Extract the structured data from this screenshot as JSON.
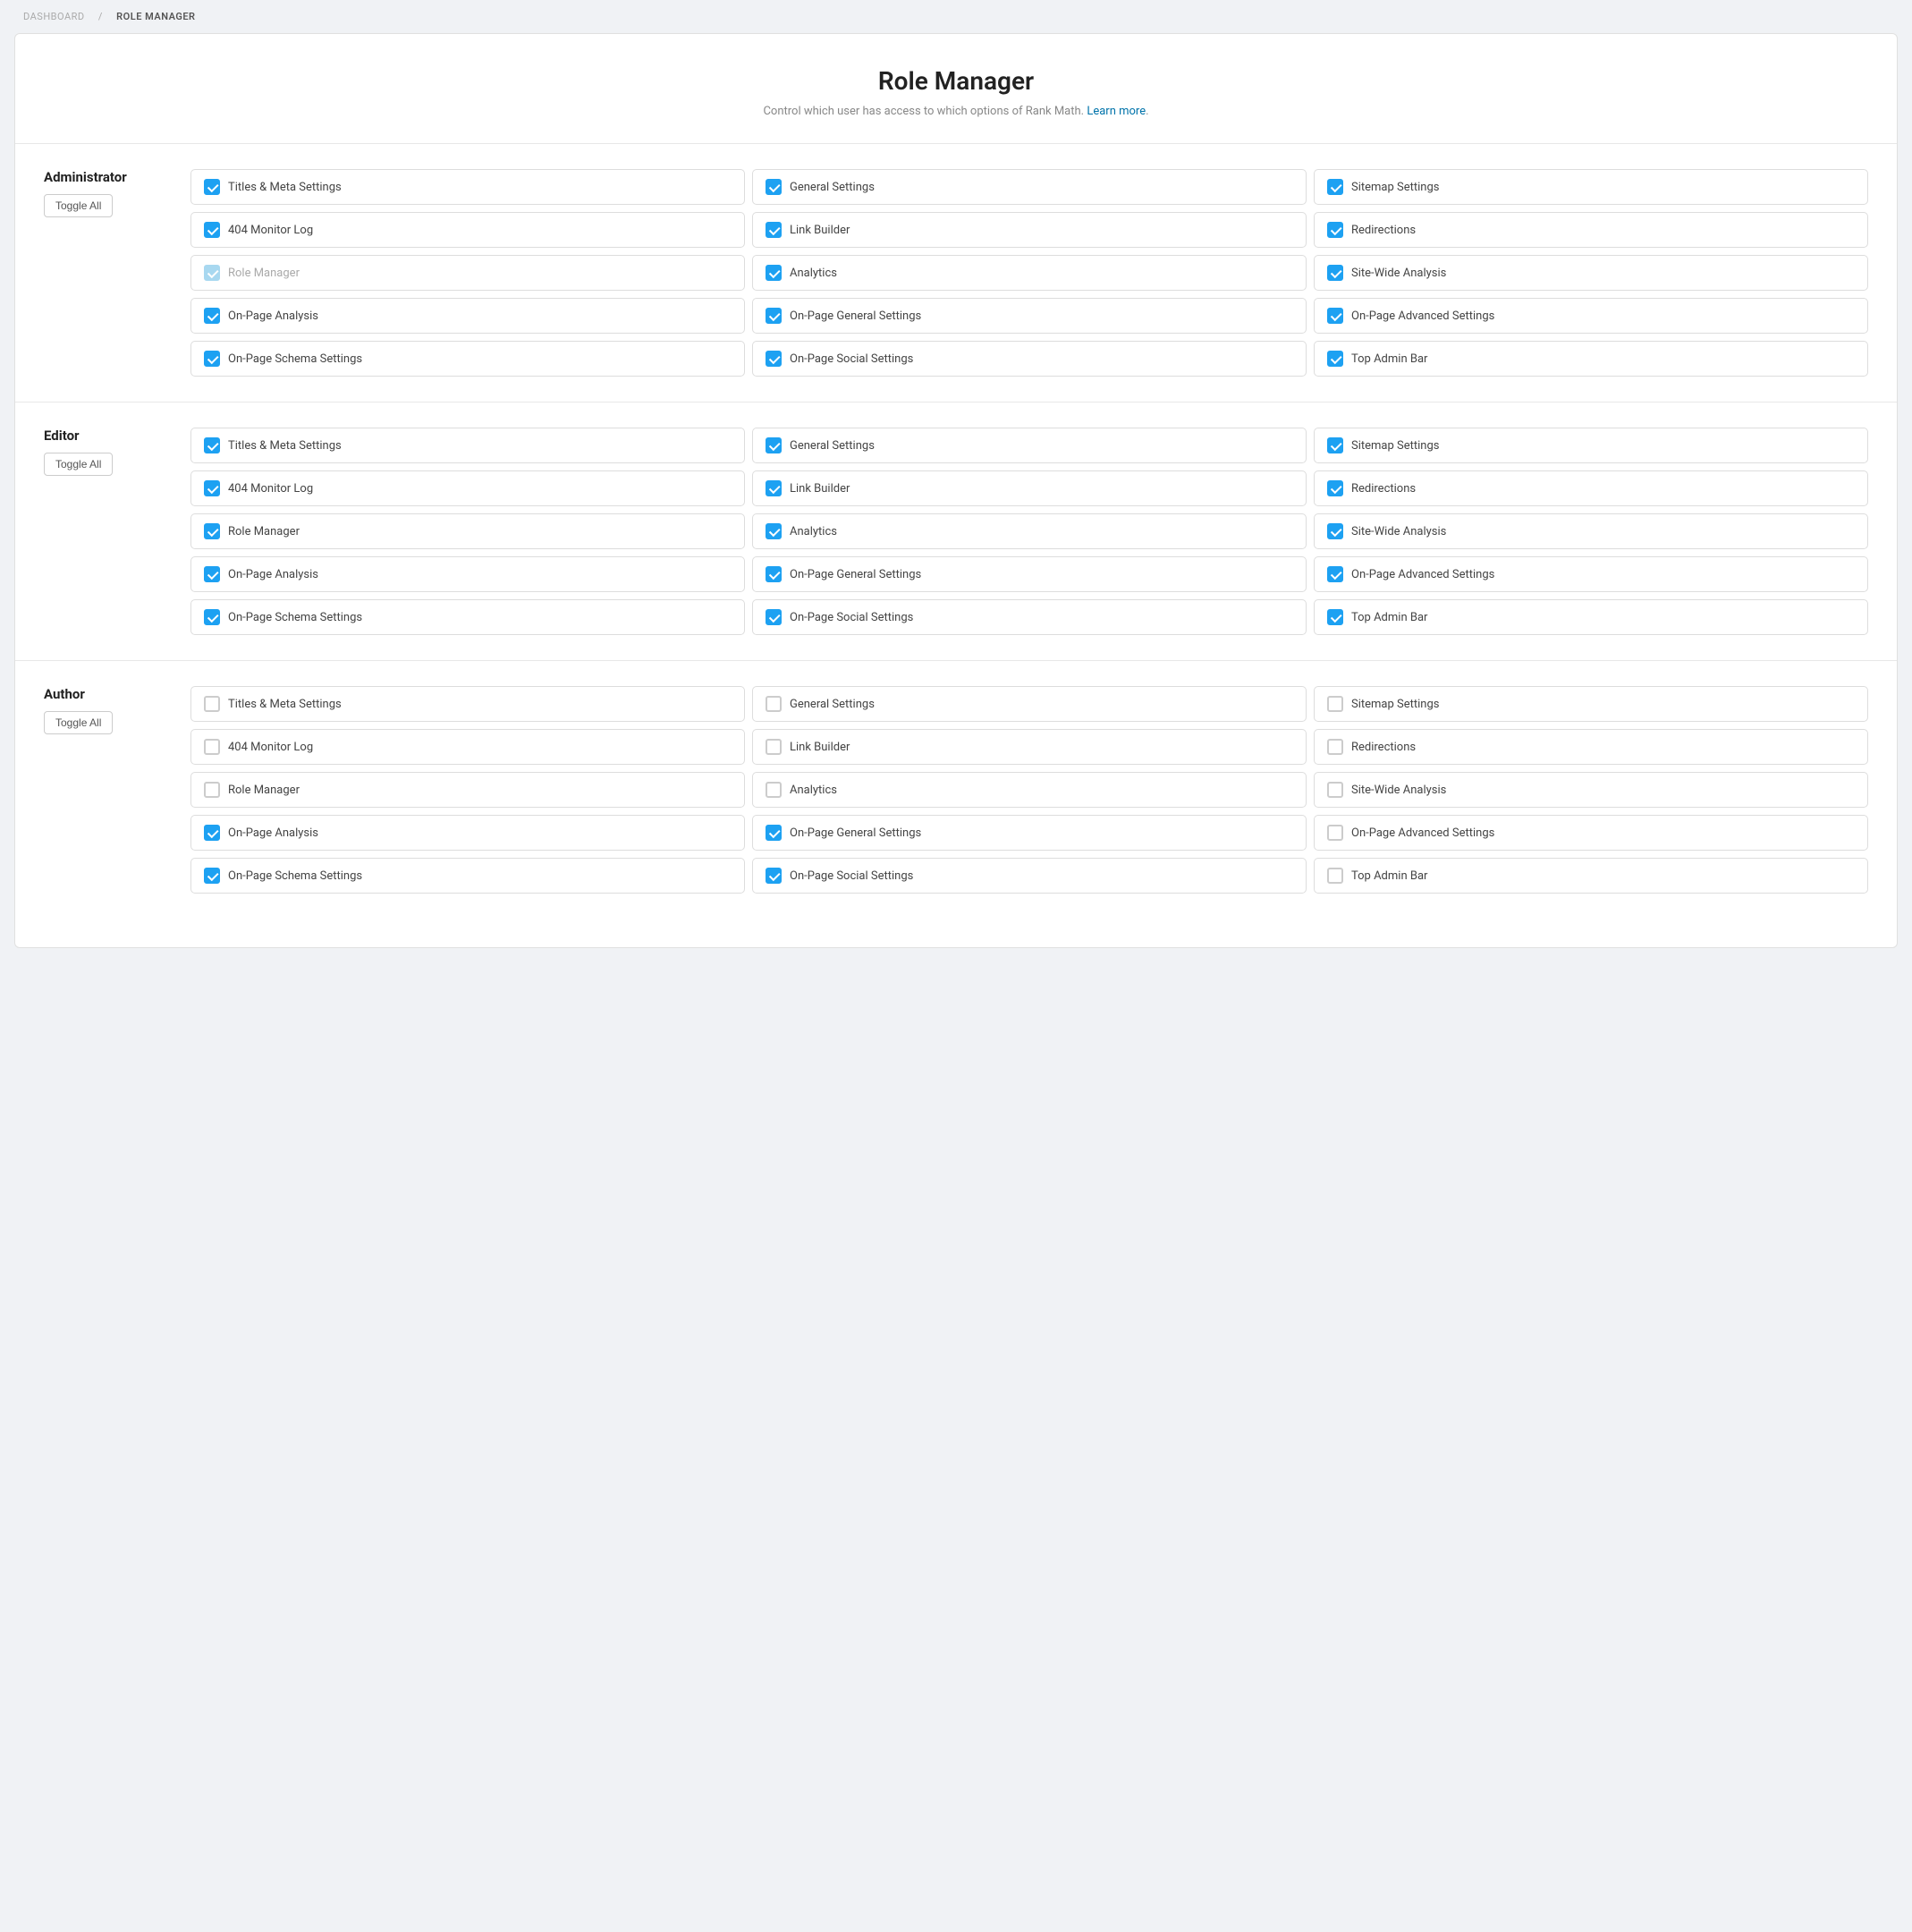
{
  "breadcrumb": {
    "dashboard": "DASHBOARD",
    "separator": "/",
    "current": "ROLE MANAGER"
  },
  "page": {
    "title": "Role Manager",
    "subtitle": "Control which user has access to which options of Rank Math.",
    "learn_more": "Learn more",
    "period": "."
  },
  "roles": [
    {
      "id": "administrator",
      "name": "Administrator",
      "toggle_label": "Toggle All",
      "permissions": [
        {
          "label": "Titles & Meta Settings",
          "state": "checked"
        },
        {
          "label": "General Settings",
          "state": "checked"
        },
        {
          "label": "Sitemap Settings",
          "state": "checked"
        },
        {
          "label": "404 Monitor Log",
          "state": "checked"
        },
        {
          "label": "Link Builder",
          "state": "checked"
        },
        {
          "label": "Redirections",
          "state": "checked"
        },
        {
          "label": "Role Manager",
          "state": "disabled-checked"
        },
        {
          "label": "Analytics",
          "state": "checked"
        },
        {
          "label": "Site-Wide Analysis",
          "state": "checked"
        },
        {
          "label": "On-Page Analysis",
          "state": "checked"
        },
        {
          "label": "On-Page General Settings",
          "state": "checked"
        },
        {
          "label": "On-Page Advanced Settings",
          "state": "checked"
        },
        {
          "label": "On-Page Schema Settings",
          "state": "checked"
        },
        {
          "label": "On-Page Social Settings",
          "state": "checked"
        },
        {
          "label": "Top Admin Bar",
          "state": "checked"
        }
      ]
    },
    {
      "id": "editor",
      "name": "Editor",
      "toggle_label": "Toggle All",
      "permissions": [
        {
          "label": "Titles & Meta Settings",
          "state": "checked"
        },
        {
          "label": "General Settings",
          "state": "checked"
        },
        {
          "label": "Sitemap Settings",
          "state": "checked"
        },
        {
          "label": "404 Monitor Log",
          "state": "checked"
        },
        {
          "label": "Link Builder",
          "state": "checked"
        },
        {
          "label": "Redirections",
          "state": "checked"
        },
        {
          "label": "Role Manager",
          "state": "checked"
        },
        {
          "label": "Analytics",
          "state": "checked"
        },
        {
          "label": "Site-Wide Analysis",
          "state": "checked"
        },
        {
          "label": "On-Page Analysis",
          "state": "checked"
        },
        {
          "label": "On-Page General Settings",
          "state": "checked"
        },
        {
          "label": "On-Page Advanced Settings",
          "state": "checked"
        },
        {
          "label": "On-Page Schema Settings",
          "state": "checked"
        },
        {
          "label": "On-Page Social Settings",
          "state": "checked"
        },
        {
          "label": "Top Admin Bar",
          "state": "checked"
        }
      ]
    },
    {
      "id": "author",
      "name": "Author",
      "toggle_label": "Toggle All",
      "permissions": [
        {
          "label": "Titles & Meta Settings",
          "state": "unchecked"
        },
        {
          "label": "General Settings",
          "state": "unchecked"
        },
        {
          "label": "Sitemap Settings",
          "state": "unchecked"
        },
        {
          "label": "404 Monitor Log",
          "state": "unchecked"
        },
        {
          "label": "Link Builder",
          "state": "unchecked"
        },
        {
          "label": "Redirections",
          "state": "unchecked"
        },
        {
          "label": "Role Manager",
          "state": "unchecked"
        },
        {
          "label": "Analytics",
          "state": "unchecked"
        },
        {
          "label": "Site-Wide Analysis",
          "state": "unchecked"
        },
        {
          "label": "On-Page Analysis",
          "state": "checked"
        },
        {
          "label": "On-Page General Settings",
          "state": "checked"
        },
        {
          "label": "On-Page Advanced Settings",
          "state": "unchecked"
        },
        {
          "label": "On-Page Schema Settings",
          "state": "checked"
        },
        {
          "label": "On-Page Social Settings",
          "state": "checked"
        },
        {
          "label": "Top Admin Bar",
          "state": "unchecked"
        }
      ]
    }
  ]
}
